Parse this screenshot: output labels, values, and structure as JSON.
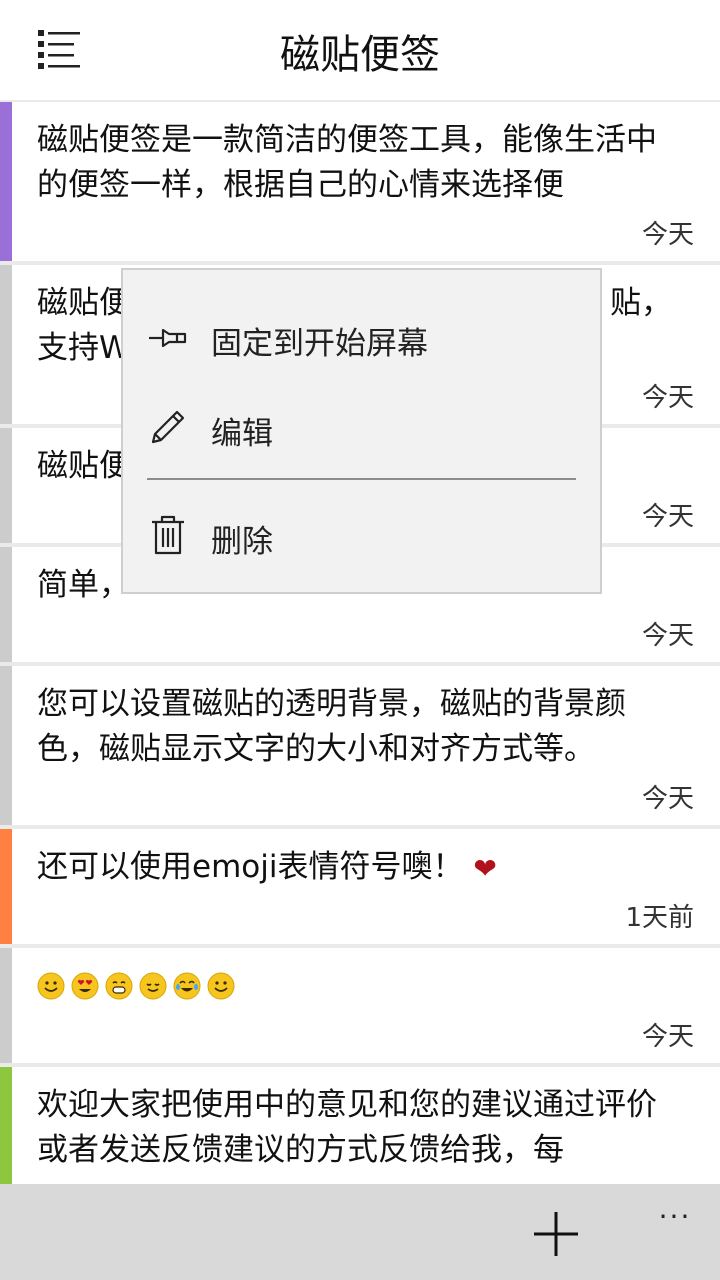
{
  "header": {
    "title": "磁贴便签"
  },
  "colors": {
    "purple": "#9b6fd8",
    "grey": "#cccccc",
    "orange": "#ff8040",
    "green": "#8dc63f"
  },
  "notes": [
    {
      "text": "磁贴便签是一款简洁的便签工具，能像生活中的便签一样，根据自己的心情来选择便",
      "time": "今天"
    },
    {
      "text_a": "磁贴便",
      "text_b": "贴，",
      "text_c": "支持W",
      "time": "今天"
    },
    {
      "text": "磁贴便",
      "time": "今天"
    },
    {
      "text": "简单，",
      "time": "今天"
    },
    {
      "text": "您可以设置磁贴的透明背景，磁贴的背景颜色，磁贴显示文字的大小和对齐方式等。",
      "time": "今天"
    },
    {
      "text": "还可以使用emoji表情符号噢！",
      "time": "1天前"
    },
    {
      "text": "",
      "time": "今天"
    },
    {
      "text": "欢迎大家把使用中的意见和您的建议通过评价或者发送反馈建议的方式反馈给我，每",
      "time": ""
    }
  ],
  "context_menu": {
    "pin": "固定到开始屏幕",
    "edit": "编辑",
    "delete": "删除"
  },
  "appbar": {
    "more": "···"
  }
}
